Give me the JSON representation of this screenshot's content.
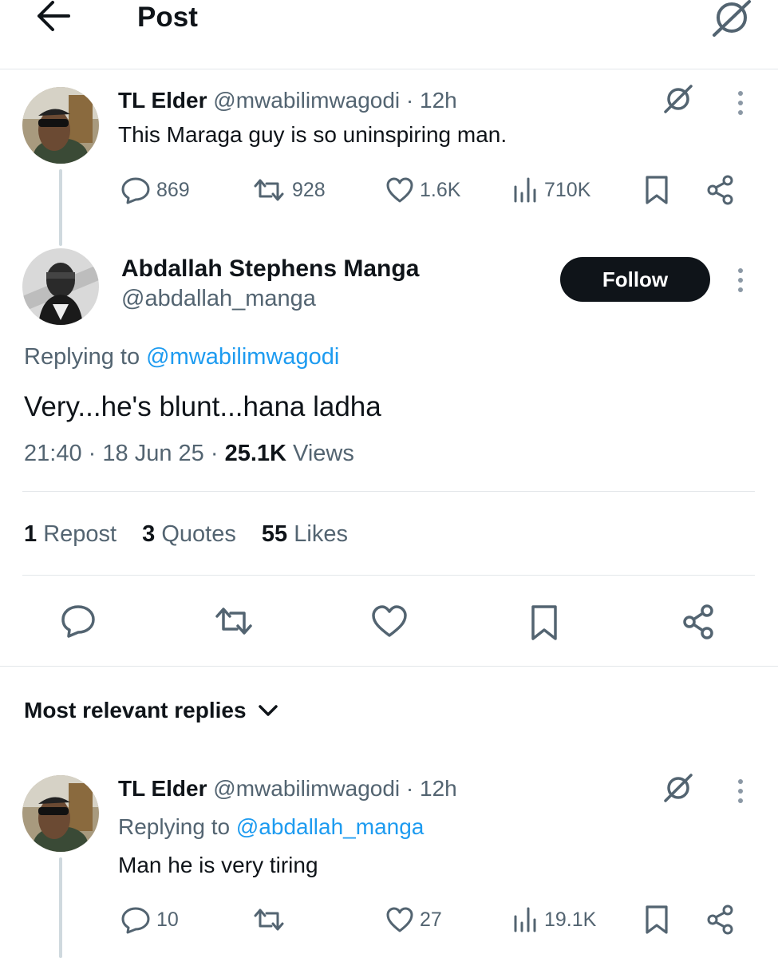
{
  "header": {
    "title": "Post",
    "back_icon": "arrow-left-icon",
    "grok_icon": "grok-icon"
  },
  "parent_tweet": {
    "author_name": "TL Elder",
    "handle": "@mwabilimwagodi",
    "separator": "·",
    "time": "12h",
    "text": "This Maraga guy is so uninspiring man.",
    "stats": {
      "replies": "869",
      "reposts": "928",
      "likes": "1.6K",
      "views": "710K"
    }
  },
  "main_tweet": {
    "author_name": "Abdallah Stephens Manga",
    "handle": "@abdallah_manga",
    "follow_label": "Follow",
    "replying_prefix": "Replying to",
    "replying_to": "@mwabilimwagodi",
    "text": "Very...he's blunt...hana ladha",
    "time": "21:40",
    "date": "18 Jun 25",
    "views_count": "25.1K",
    "views_label": "Views",
    "sep1": "·",
    "sep2": "·",
    "reposts_count": "1",
    "reposts_label": "Repost",
    "quotes_count": "3",
    "quotes_label": "Quotes",
    "likes_count": "55",
    "likes_label": "Likes"
  },
  "replies_section": {
    "sort_label": "Most relevant replies"
  },
  "reply_tweet": {
    "author_name": "TL Elder",
    "handle": "@mwabilimwagodi",
    "separator": "·",
    "time": "12h",
    "replying_prefix": "Replying to",
    "replying_to": "@abdallah_manga",
    "text": "Man he is very tiring",
    "stats": {
      "replies": "10",
      "likes": "27",
      "views": "19.1K"
    }
  },
  "colors": {
    "text": "#0f1419",
    "secondary": "#536471",
    "link": "#1d9bf0",
    "follow_bg": "#0f1419",
    "divider": "#e3e7ea"
  }
}
